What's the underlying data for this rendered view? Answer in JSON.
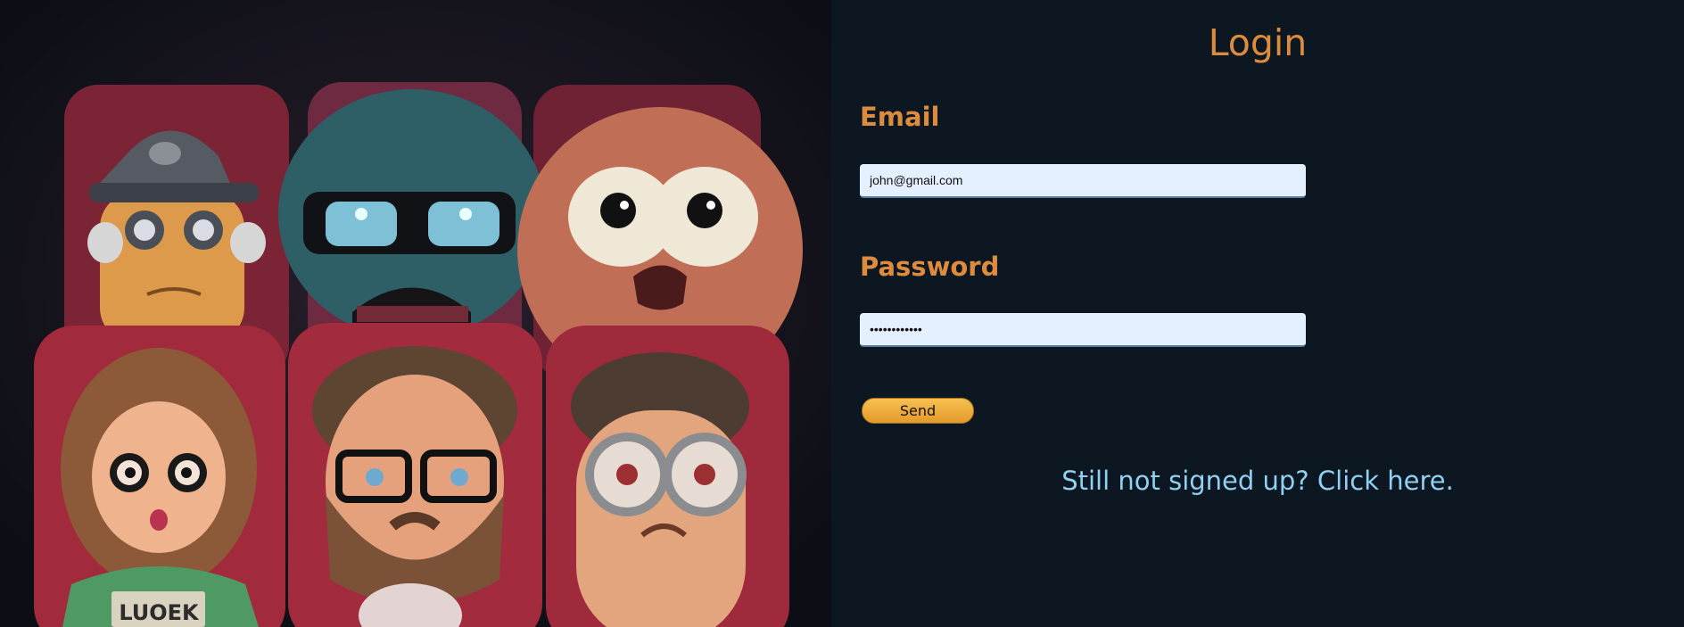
{
  "login": {
    "title": "Login",
    "email_label": "Email",
    "email_value": "john@gmail.com",
    "password_label": "Password",
    "password_value": "••••••••••••",
    "send_label": "Send",
    "signup_link": "Still not signed up? Click here."
  },
  "colors": {
    "accent": "#dd8b3d",
    "link": "#8fd0f3",
    "panel_background": "#0c1722",
    "input_background": "#e4efff",
    "button": "#f0aa3c"
  },
  "hero_image": {
    "subject": "six cartoon characters and monsters in red cinema seats",
    "seat_text": "LUOEK"
  }
}
